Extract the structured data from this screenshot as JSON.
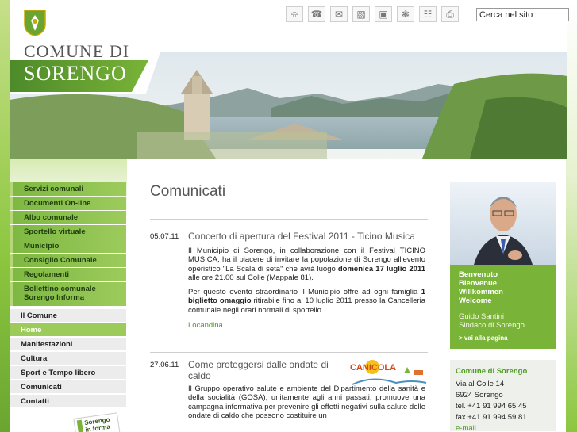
{
  "header": {
    "logo_line1": "COMUNE DI",
    "logo_line2": "SORENGO",
    "search_value": "Cerca nel sito"
  },
  "toolbar": {
    "icons": [
      "bell-icon",
      "phone-icon",
      "mail-icon",
      "map-icon",
      "camera-icon",
      "bike-icon",
      "sitemap-icon",
      "print-icon"
    ]
  },
  "nav": {
    "primary": [
      "Servizi comunali",
      "Documenti On-line",
      "Albo comunale",
      "Sportello virtuale",
      "Municipio",
      "Consiglio Comunale",
      "Regolamenti",
      "Bollettino comunale Sorengo Informa"
    ],
    "secondary": [
      "Il Comune",
      "Home",
      "Manifestazioni",
      "Cultura",
      "Sport e Tempo libero",
      "Comunicati",
      "Contatti"
    ],
    "badge_line1": "Sorengo",
    "badge_line2": "in forma"
  },
  "main": {
    "title": "Comunicati",
    "entries": [
      {
        "date": "05.07.11",
        "title": "Concerto di apertura del Festival 2011 - Ticino Musica",
        "p1_a": "Il Municipio di Sorengo, in collaborazione con il Festival TICINO MUSICA, ha il piacere di invitare la popolazione di Sorengo all'evento operistico \"La Scala di seta\" che avrà luogo ",
        "p1_bold": "domenica 17 luglio 2011",
        "p1_b": " alle ore 21.00 sul Colle (Mappale 81).",
        "p2_a": "Per questo evento straordinario il Municipio offre ad ogni famiglia ",
        "p2_bold": "1 biglietto omaggio",
        "p2_b": " ritirabile fino al 10 luglio 2011 presso la Cancelleria comunale negli orari normali di sportello.",
        "link": "Locandina"
      },
      {
        "date": "27.06.11",
        "title": "Come proteggersi dalle ondate di caldo",
        "body": "Il Gruppo operativo salute e ambiente del Dipartimento della sanità e della socialità (GOSA), unitamente agli anni passati, promuove una campagna informativa per prevenire gli effetti negativi sulla salute delle ondate di caldo che possono costituire un",
        "image_text": "CANICOLA"
      }
    ]
  },
  "welcome": {
    "lines": [
      "Benvenuto",
      "Bienvenue",
      "Willkommen",
      "Welcome"
    ],
    "mayor_name": "Guido Santini",
    "mayor_title": "Sindaco di Sorengo",
    "link": "> vai alla pagina"
  },
  "contact": {
    "title": "Comune di Sorengo",
    "street": "Via al Colle 14",
    "city": "6924 Sorengo",
    "tel": "tel. +41 91 994 65 45",
    "fax": "fax +41 91 994 59 81",
    "email": "e-mail"
  },
  "colors": {
    "brand_green": "#79b337",
    "dark_green": "#4d8a2a",
    "link_green": "#4c9a1f"
  }
}
